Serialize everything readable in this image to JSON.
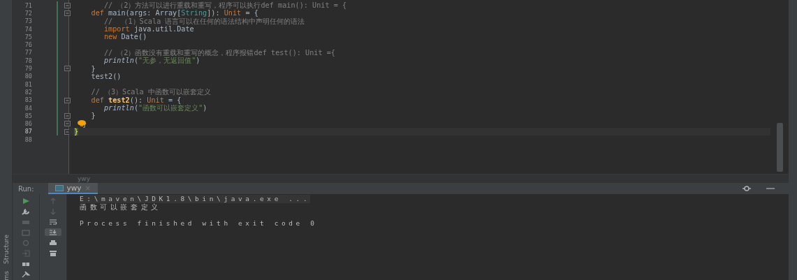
{
  "editor": {
    "lines": [
      {
        "number": "71",
        "current": false,
        "fold": true,
        "tokens": [
          {
            "kind": "comment",
            "text": "       // （2）方法可以进行重载和重写，程序可以执行def main(): Unit = {"
          }
        ]
      },
      {
        "number": "72",
        "current": false,
        "fold": true,
        "tokens": [
          {
            "kind": "kw",
            "text": "    def "
          },
          {
            "kind": "plain",
            "text": "main(args: Array["
          },
          {
            "kind": "type",
            "text": "String"
          },
          {
            "kind": "plain",
            "text": "]): "
          },
          {
            "kind": "kw",
            "text": "Unit"
          },
          {
            "kind": "plain",
            "text": " = {"
          }
        ]
      },
      {
        "number": "73",
        "current": false,
        "fold": false,
        "tokens": [
          {
            "kind": "comment",
            "text": "       //  （1）Scala 语言可以在任何的语法结构中声明任何的语法"
          }
        ]
      },
      {
        "number": "74",
        "current": false,
        "fold": false,
        "tokens": [
          {
            "kind": "kw",
            "text": "       import "
          },
          {
            "kind": "plain",
            "text": "java.util.Date"
          }
        ]
      },
      {
        "number": "75",
        "current": false,
        "fold": false,
        "tokens": [
          {
            "kind": "kw",
            "text": "       new "
          },
          {
            "kind": "plain",
            "text": "Date()"
          }
        ]
      },
      {
        "number": "76",
        "current": false,
        "fold": false
      },
      {
        "number": "77",
        "current": false,
        "fold": false,
        "tokens": [
          {
            "kind": "comment",
            "text": "       // （2）函数没有重载和重写的概念，程序报错def test(): Unit ={"
          }
        ]
      },
      {
        "number": "78",
        "current": false,
        "fold": false,
        "tokens": [
          {
            "kind": "call",
            "text": "       println"
          },
          {
            "kind": "plain",
            "text": "("
          },
          {
            "kind": "string",
            "text": "\"无参，无返回值\""
          },
          {
            "kind": "plain",
            "text": ")"
          }
        ]
      },
      {
        "number": "79",
        "current": false,
        "fold": true,
        "tokens": [
          {
            "kind": "plain",
            "text": "    }"
          }
        ]
      },
      {
        "number": "80",
        "current": false,
        "fold": false,
        "tokens": [
          {
            "kind": "plain",
            "text": "    test2()"
          }
        ]
      },
      {
        "number": "81",
        "current": false,
        "fold": false
      },
      {
        "number": "82",
        "current": false,
        "fold": false,
        "tokens": [
          {
            "kind": "comment",
            "text": "    // （3）Scala 中函数可以嵌套定义"
          }
        ]
      },
      {
        "number": "83",
        "current": false,
        "fold": true,
        "tokens": [
          {
            "kind": "kw",
            "text": "    def "
          },
          {
            "kind": "fn",
            "text": "test2"
          },
          {
            "kind": "plain",
            "text": "(): "
          },
          {
            "kind": "kw",
            "text": "Unit"
          },
          {
            "kind": "plain",
            "text": " = {"
          }
        ]
      },
      {
        "number": "84",
        "current": false,
        "fold": false,
        "tokens": [
          {
            "kind": "call",
            "text": "       println"
          },
          {
            "kind": "plain",
            "text": "("
          },
          {
            "kind": "string",
            "text": "\"函数可以嵌套定义\""
          },
          {
            "kind": "plain",
            "text": ")"
          }
        ]
      },
      {
        "number": "85",
        "current": false,
        "fold": true,
        "tokens": [
          {
            "kind": "plain",
            "text": "    }"
          }
        ]
      },
      {
        "number": "86",
        "current": false,
        "fold": true,
        "bulb": true,
        "tokens": [
          {
            "kind": "plain",
            "text": "  }"
          }
        ]
      },
      {
        "number": "87",
        "current": true,
        "fold": true,
        "tokens": [
          {
            "kind": "brace",
            "text": "}"
          }
        ]
      },
      {
        "number": "88",
        "current": false,
        "fold": false
      }
    ]
  },
  "breadcrumb": "ywy",
  "run_panel": {
    "label": "Run:",
    "tabs": [
      {
        "label": "ywy",
        "selected": true,
        "close": "×"
      }
    ],
    "console": [
      {
        "kind": "command",
        "text": "E:\\maven\\JDK1.8\\bin\\java.exe ..."
      },
      {
        "kind": "output",
        "text": "函数可以嵌套定义"
      },
      {
        "kind": "blank"
      },
      {
        "kind": "output",
        "text": "Process finished with exit code 0"
      }
    ]
  },
  "side_tool_labels": [
    "Structure",
    "ms"
  ]
}
